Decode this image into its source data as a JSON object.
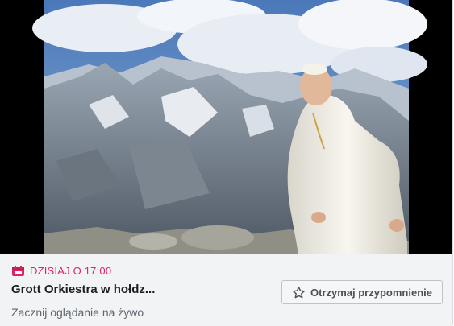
{
  "event": {
    "time_label": "DZISIAJ O 17:00",
    "title": "Grott Orkiestra w hołdz...",
    "subtitle": "Zacznij oglądanie na żywo",
    "remind_button_label": "Otrzymaj przypomnienie"
  },
  "icons": {
    "calendar": "calendar-icon",
    "star": "star-outline-icon"
  },
  "colors": {
    "accent_red": "#e0245e",
    "title_text": "#1c1e21",
    "subtitle_text": "#606770",
    "footer_bg": "#f2f3f5"
  }
}
